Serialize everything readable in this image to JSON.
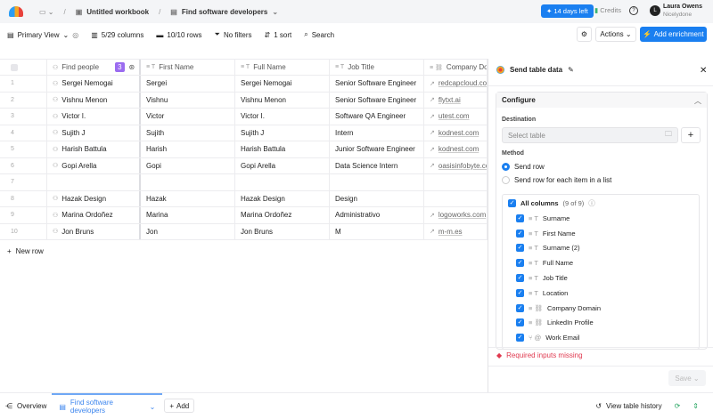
{
  "topbar": {
    "workbook": "Untitled workbook",
    "table": "Find software developers",
    "trial": "14 days left",
    "credits": "Credits",
    "help": "?",
    "user_initial": "L",
    "user_name": "Laura Owens",
    "user_org": "Nicelydone"
  },
  "toolbar": {
    "view": "Primary View",
    "columns": "5/29 columns",
    "rows": "10/10 rows",
    "filters": "No filters",
    "sort": "1 sort",
    "search": "Search",
    "actions": "Actions",
    "add_enrichment": "Add enrichment"
  },
  "table": {
    "headers": [
      "Find people",
      "First Name",
      "Full Name",
      "Job Title",
      "Company Do"
    ],
    "badge": "3",
    "rows": [
      [
        "1",
        "Sergei Nemogai",
        "Sergei",
        "Sergei Nemogai",
        "Senior Software Engineer",
        "redcapcloud.com"
      ],
      [
        "2",
        "Vishnu Menon",
        "Vishnu",
        "Vishnu Menon",
        "Senior Software Engineer",
        "flytxt.ai"
      ],
      [
        "3",
        "Victor I.",
        "Victor",
        "Victor I.",
        "Software QA Engineer",
        "utest.com"
      ],
      [
        "4",
        "Sujith J",
        "Sujith",
        "Sujith J",
        "Intern",
        "kodnest.com"
      ],
      [
        "5",
        "Harish Battula",
        "Harish",
        "Harish Battula",
        "Junior Software Engineer",
        "kodnest.com"
      ],
      [
        "6",
        "Gopi Arella",
        "Gopi",
        "Gopi Arella",
        "Data Science Intern",
        "oasisinfobyte.com"
      ],
      [
        "7",
        "",
        "",
        "",
        "",
        ""
      ],
      [
        "8",
        "Hazak Design",
        "Hazak",
        "Hazak Design",
        "Design",
        ""
      ],
      [
        "9",
        "Marina Ordoñez",
        "Marina",
        "Marina Ordoñez",
        "Administrativo",
        "logoworks.com"
      ],
      [
        "10",
        "Jon Bruns",
        "Jon",
        "Jon Bruns",
        "M",
        "m-m.es"
      ]
    ],
    "new_row": "New row"
  },
  "panel": {
    "title": "Send table data",
    "configure": "Configure",
    "destination": "Destination",
    "destination_placeholder": "Select table",
    "method": "Method",
    "method_options": [
      "Send row",
      "Send row for each item in a list"
    ],
    "all_columns": "All columns",
    "all_count": "(9 of 9)",
    "columns": [
      "Surname",
      "First Name",
      "Surname (2)",
      "Full Name",
      "Job Title",
      "Location",
      "Company Domain",
      "LinkedIn Profile",
      "Work Email"
    ],
    "error": "Required inputs missing",
    "save": "Save"
  },
  "bottom": {
    "overview": "Overview",
    "tab": "Find software developers",
    "add": "Add",
    "history": "View table history"
  }
}
